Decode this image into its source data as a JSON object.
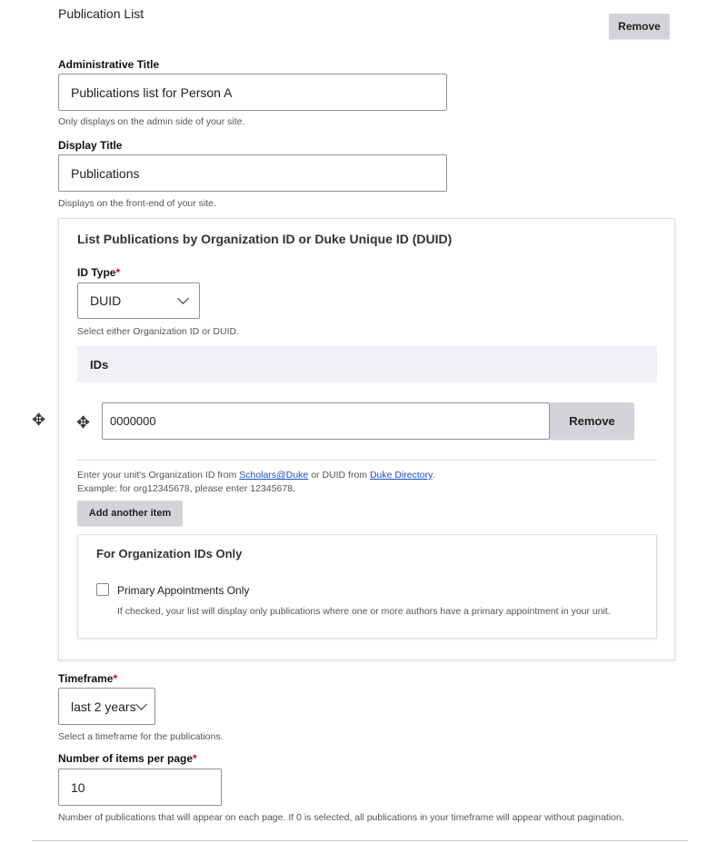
{
  "section_title": "Publication List",
  "remove_label": "Remove",
  "admin_title": {
    "label": "Administrative Title",
    "value": "Publications list for Person A",
    "help": "Only displays on the admin side of your site."
  },
  "display_title": {
    "label": "Display Title",
    "value": "Publications",
    "help": "Displays on the front-end of your site."
  },
  "list_by": {
    "heading": "List Publications by Organization ID or Duke Unique ID (DUID)",
    "id_type": {
      "label": "ID Type",
      "required": "*",
      "value": "DUID",
      "help": "Select either Organization ID or DUID."
    },
    "ids": {
      "header": "IDs",
      "items": [
        {
          "value": "0000000",
          "remove_label": "Remove"
        }
      ],
      "help_prefix": "Enter your unit's Organization ID from ",
      "link1": "Scholars@Duke",
      "help_mid": " or DUID from ",
      "link2": "Duke Directory",
      "help_suffix": ".",
      "help_line2": "Example: for org12345678, please enter 12345678.",
      "add_label": "Add another item"
    },
    "org_only": {
      "heading": "For Organization IDs Only",
      "checkbox_label": "Primary Appointments Only",
      "checked": false,
      "help": "If checked, your list will display only publications where one or more authors have a primary appointment in your unit."
    }
  },
  "timeframe": {
    "label": "Timeframe",
    "required": "*",
    "value": "last 2 years",
    "help": "Select a timeframe for the publications."
  },
  "items_per_page": {
    "label": "Number of items per page",
    "required": "*",
    "value": "10",
    "help": "Number of publications that will appear on each page. If 0 is selected, all publications in your timeframe will appear without pagination."
  },
  "colors": {
    "button_bg": "#d4d4d8",
    "link": "#1a4fc9",
    "required": "#dd0000",
    "ids_header_bg": "#f1f1f5"
  }
}
